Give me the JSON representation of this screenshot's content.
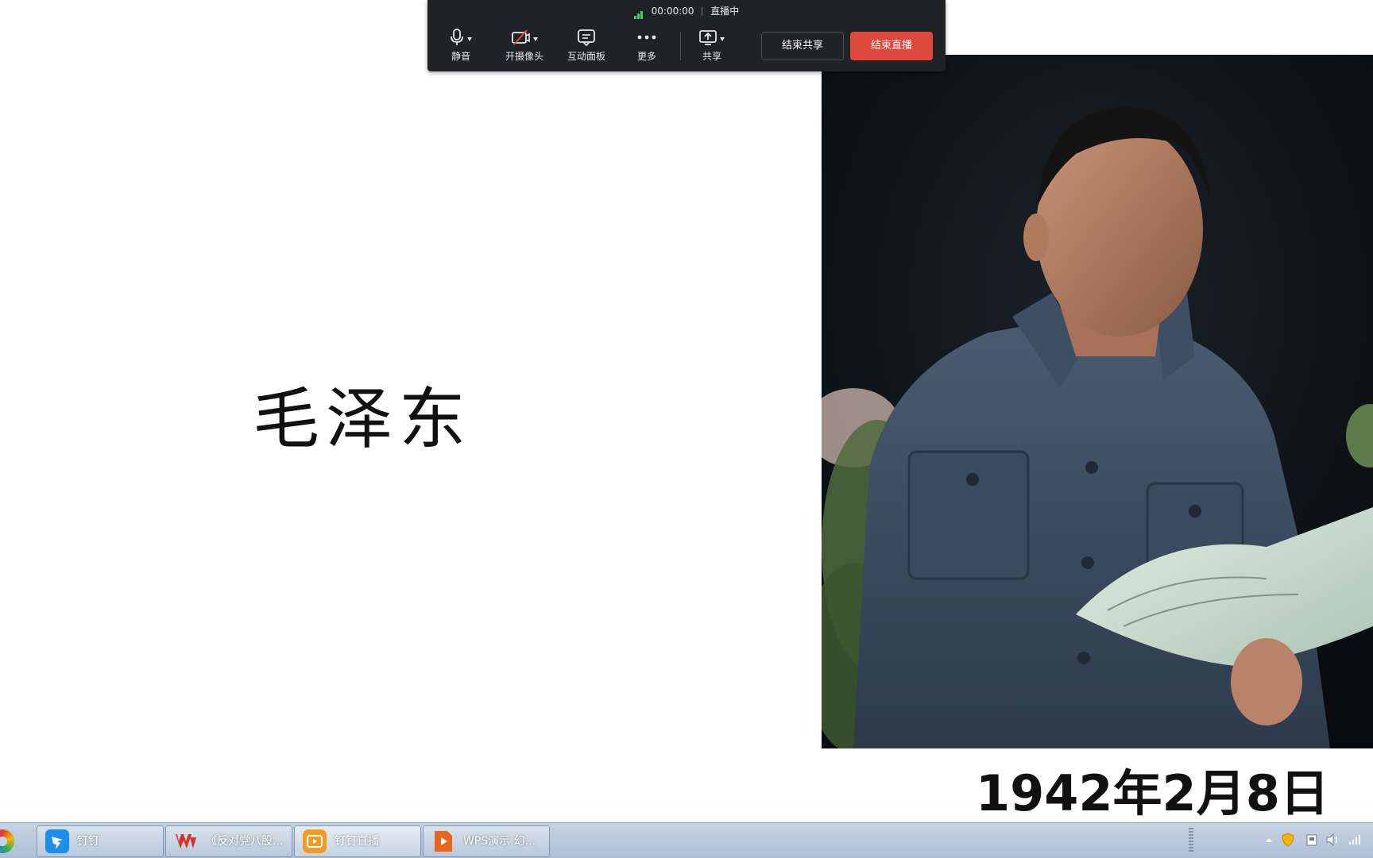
{
  "toolbar": {
    "timer": "00:00:00",
    "status": "直播中",
    "mute_label": "静音",
    "camera_label": "开摄像头",
    "panel_label": "互动面板",
    "more_label": "更多",
    "share_label": "共享",
    "end_share_label": "结束共享",
    "end_live_label": "结束直播",
    "signal_color": "#3ccf6b",
    "end_live_color": "#e0483c"
  },
  "slide": {
    "name": "毛泽东",
    "date": "1942年2月8日"
  },
  "taskbar": {
    "items": [
      {
        "label": "钉钉",
        "icon": "dingtalk-icon"
      },
      {
        "label": "《反对党八股...",
        "icon": "wps-writer-icon"
      },
      {
        "label": "钉钉直播",
        "icon": "dingtalk-live-icon"
      },
      {
        "label": "WPS演示 幻...",
        "icon": "wps-presentation-icon"
      }
    ],
    "tray_icons": [
      "show-hidden-icon",
      "security-shield-icon",
      "network-adapter-icon",
      "volume-icon",
      "signal-icon"
    ]
  }
}
